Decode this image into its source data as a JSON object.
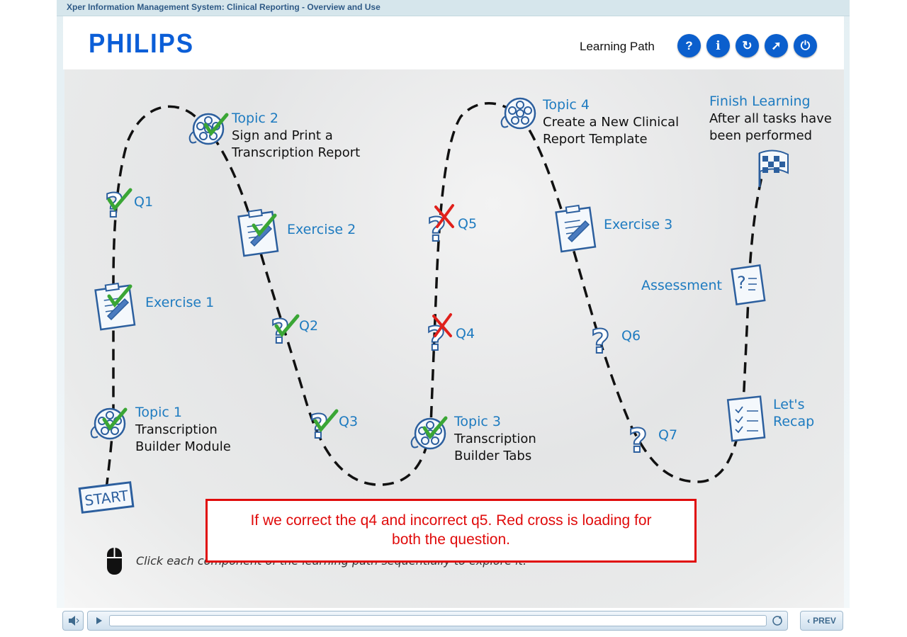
{
  "window": {
    "title": "Xper Information Management System: Clinical Reporting - Overview and Use"
  },
  "header": {
    "logo": "PHILIPS",
    "learning_path_label": "Learning Path",
    "buttons": [
      {
        "name": "help",
        "glyph": "?"
      },
      {
        "name": "info",
        "glyph": "i"
      },
      {
        "name": "replay",
        "glyph": "↻"
      },
      {
        "name": "compass",
        "glyph": "➚"
      },
      {
        "name": "power",
        "glyph": "⏻"
      }
    ]
  },
  "path": {
    "start_label": "START",
    "topic1": {
      "title": "Topic 1",
      "subtitle_line1": "Transcription",
      "subtitle_line2": "Builder Module",
      "status": "complete"
    },
    "exercise1": {
      "label": "Exercise 1",
      "status": "complete"
    },
    "q1": {
      "label": "Q1",
      "status": "correct"
    },
    "topic2": {
      "title": "Topic 2",
      "subtitle_line1": "Sign and Print a",
      "subtitle_line2": "Transcription Report",
      "status": "complete"
    },
    "exercise2": {
      "label": "Exercise 2",
      "status": "complete"
    },
    "q2": {
      "label": "Q2",
      "status": "correct"
    },
    "q3": {
      "label": "Q3",
      "status": "correct"
    },
    "topic3": {
      "title": "Topic 3",
      "subtitle_line1": "Transcription",
      "subtitle_line2": "Builder Tabs",
      "status": "complete"
    },
    "q4": {
      "label": "Q4",
      "status": "incorrect"
    },
    "q5": {
      "label": "Q5",
      "status": "incorrect"
    },
    "topic4": {
      "title": "Topic 4",
      "subtitle_line1": "Create a New Clinical",
      "subtitle_line2": "Report Template",
      "status": "not-started"
    },
    "exercise3": {
      "label": "Exercise 3",
      "status": "not-started"
    },
    "q6": {
      "label": "Q6",
      "status": "not-started"
    },
    "q7": {
      "label": "Q7",
      "status": "not-started"
    },
    "recap": {
      "line1": "Let's",
      "line2": "Recap",
      "status": "not-started"
    },
    "assessment": {
      "label": "Assessment",
      "status": "not-started"
    },
    "finish": {
      "title": "Finish Learning",
      "subtitle_line1": "After all tasks have",
      "subtitle_line2": "been performed"
    }
  },
  "annotation": {
    "line1": "If we correct the q4 and incorrect q5. Red cross is loading for",
    "line2": "both the question."
  },
  "hint": "Click each component of the learning path sequentially to explore it.",
  "player": {
    "prev_label": "PREV"
  },
  "colors": {
    "accent": "#0b5fcd",
    "label_blue": "#1e7bc0",
    "check_green": "#3aa635",
    "cross_red": "#e0201b",
    "annotation_red": "#e00b0b"
  }
}
